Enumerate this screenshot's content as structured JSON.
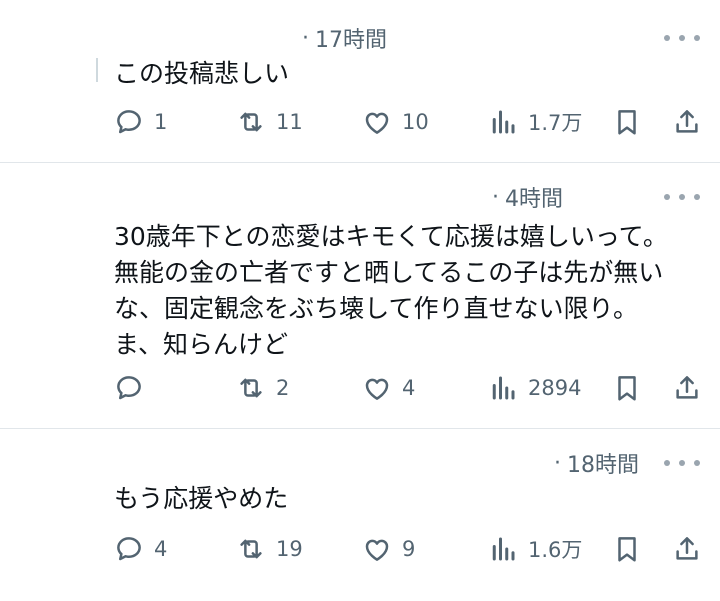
{
  "tweets": [
    {
      "time": "17時間",
      "text": "この投稿悲しい",
      "replies": "1",
      "reposts": "11",
      "likes": "10",
      "views": "1.7万"
    },
    {
      "time": "4時間",
      "text": "30歳年下との恋愛はキモくて応援は嬉しいって。\n無能の金の亡者ですと晒してるこの子は先が無い\nな、固定観念をぶち壊して作り直せない限り。\nま、知らんけど",
      "replies": "",
      "reposts": "2",
      "likes": "4",
      "views": "2894"
    },
    {
      "time": "18時間",
      "text": "もう応援やめた",
      "replies": "4",
      "reposts": "19",
      "likes": "9",
      "views": "1.6万"
    }
  ],
  "ui": {
    "separator": "·",
    "icons": [
      "reply-icon",
      "repost-icon",
      "like-icon",
      "views-icon",
      "bookmark-icon",
      "share-icon",
      "more-icon"
    ],
    "colors": {
      "text": "#0f1419",
      "secondary": "#536471",
      "divider": "#e1e6ea"
    }
  }
}
